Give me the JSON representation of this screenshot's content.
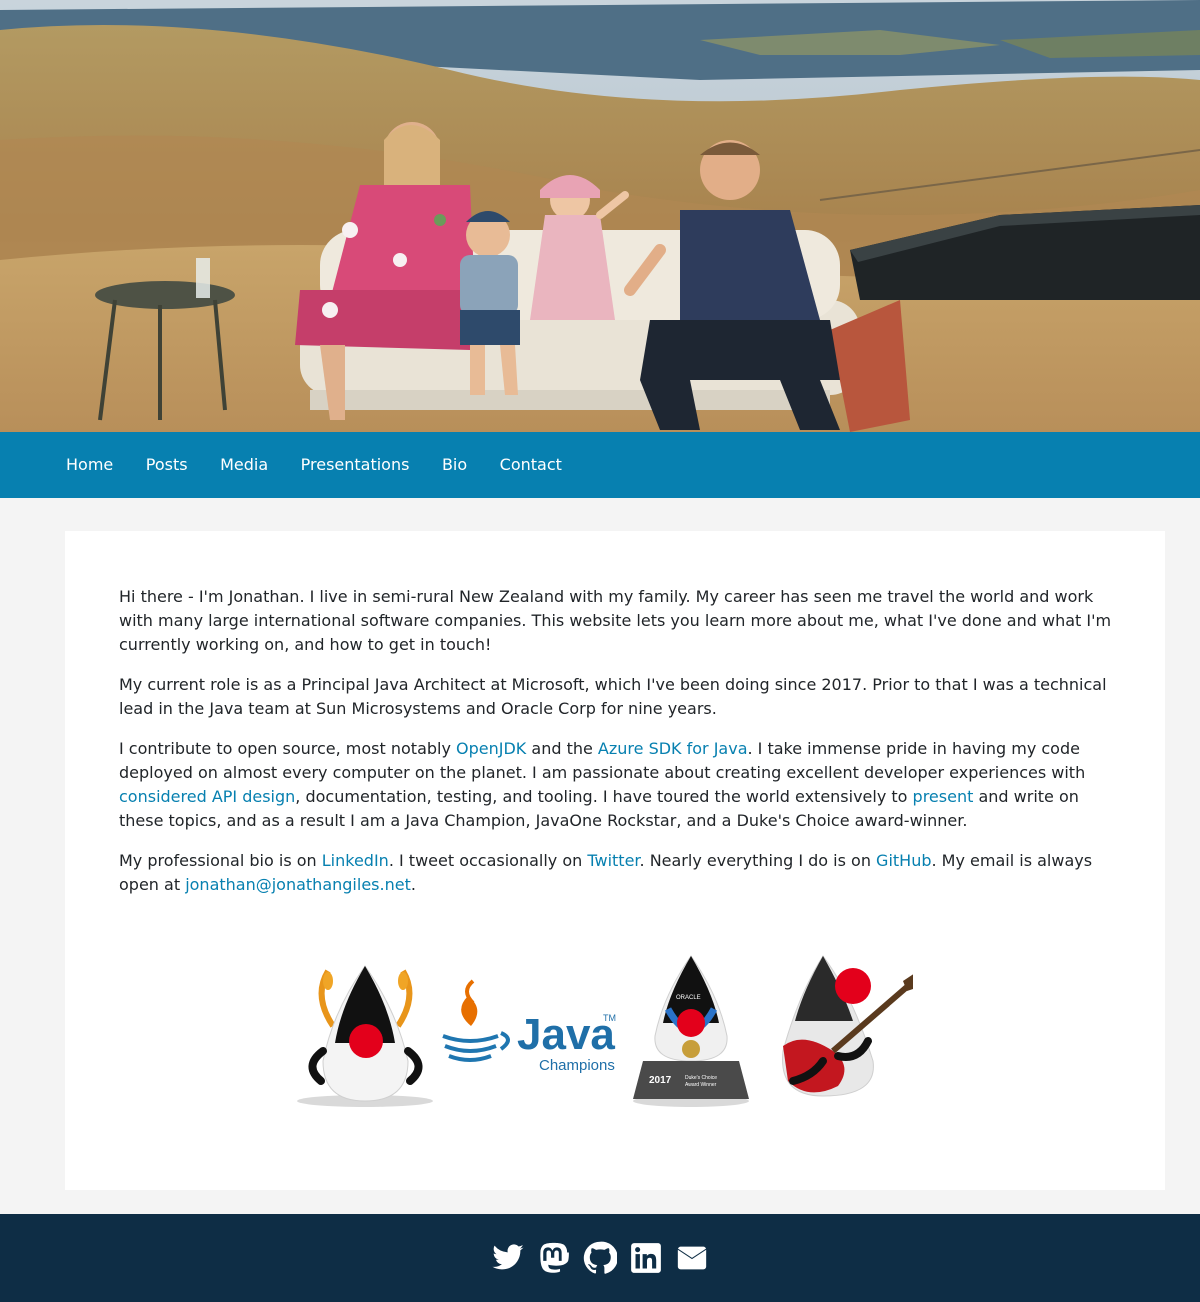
{
  "hero": {
    "image_alt": "Family sitting on an outdoor sofa on a grassy hillside overlooking the sea"
  },
  "nav": {
    "items": [
      "Home",
      "Posts",
      "Media",
      "Presentations",
      "Bio",
      "Contact"
    ]
  },
  "intro": {
    "p1": "Hi there - I'm Jonathan. I live in semi-rural New Zealand with my family. My career has seen me travel the world and work with many large international software companies. This website lets you learn more about me, what I've done and what I'm currently working on, and how to get in touch!",
    "p2": "My current role is as a Principal Java Architect at Microsoft, which I've been doing since 2017. Prior to that I was a technical lead in the Java team at Sun Microsystems and Oracle Corp for nine years.",
    "p3": {
      "t1": "I contribute to open source, most notably ",
      "l1": "OpenJDK",
      "t2": " and the ",
      "l2": "Azure SDK for Java",
      "t3": ". I take immense pride in having my code deployed on almost every computer on the planet. I am passionate about creating excellent developer experiences with ",
      "l3": "considered API design",
      "t4": ", documentation, testing, and tooling. I have toured the world extensively to ",
      "l4": "present",
      "t5": " and write on these topics, and as a result I am a Java Champion, JavaOne Rockstar, and a Duke's Choice award-winner."
    },
    "p4": {
      "t1": "My professional bio is on ",
      "l1": "LinkedIn",
      "t2": ". I tweet occasionally on ",
      "l2": "Twitter",
      "t3": ". Nearly everything I do is on ",
      "l3": "GitHub",
      "t4": ". My email is always open at ",
      "l4": "jonathan@jonathangiles.net",
      "t5": "."
    }
  },
  "badges": {
    "java_word": "Java",
    "tm": "TM",
    "champions": "Champions",
    "award_year": "2017",
    "award_line1": "Duke's Choice",
    "award_line2": "Award Winner",
    "ribbon": "ORACLE"
  },
  "footer": {
    "icons": [
      "twitter-icon",
      "mastodon-icon",
      "github-icon",
      "linkedin-icon",
      "email-icon"
    ]
  },
  "colors": {
    "accent": "#0780b0",
    "footer": "#0e2d45",
    "page_bg": "#f4f4f4"
  }
}
